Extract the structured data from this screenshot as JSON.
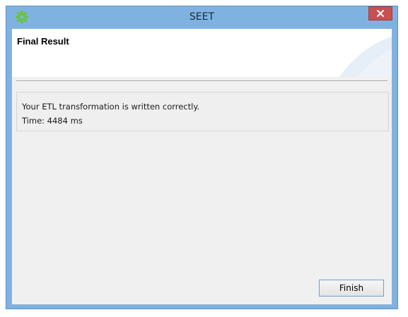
{
  "window": {
    "title": "SEET",
    "close_symbol": "×"
  },
  "header": {
    "title": "Final Result"
  },
  "message": {
    "line1": "Your ETL transformation is written correctly.",
    "line2": "Time: 4484 ms"
  },
  "footer": {
    "finish_label": "Finish"
  },
  "icons": {
    "app": "green-gear-icon",
    "close": "close-icon"
  },
  "colors": {
    "titlebar": "#7fb2e0",
    "close_button": "#c75050",
    "client_background": "#f0f0f0",
    "app_icon": "#6cc24a"
  }
}
